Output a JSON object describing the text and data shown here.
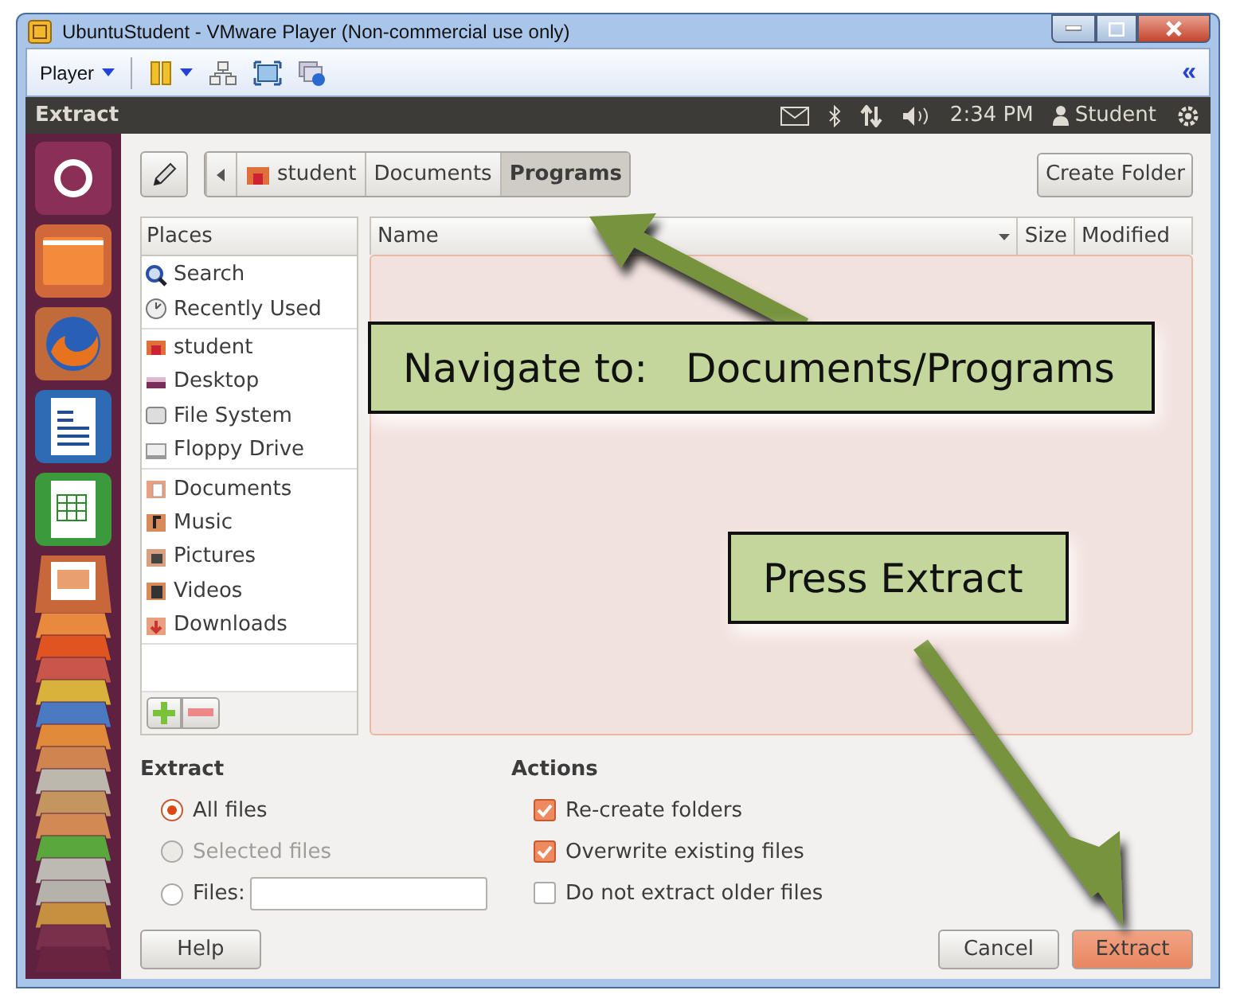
{
  "window": {
    "title": "UbuntuStudent - VMware Player (Non-commercial use only)"
  },
  "toolbar": {
    "player_menu": "Player",
    "collapse": "«"
  },
  "top_panel": {
    "app_title": "Extract",
    "time": "2:34 PM",
    "user": "Student"
  },
  "breadcrumb": [
    {
      "label": "student",
      "selected": false
    },
    {
      "label": "Documents",
      "selected": false
    },
    {
      "label": "Programs",
      "selected": true
    }
  ],
  "create_folder": "Create Folder",
  "places": {
    "header": "Places",
    "groups": [
      [
        {
          "label": "Search"
        },
        {
          "label": "Recently Used"
        }
      ],
      [
        {
          "label": "student"
        },
        {
          "label": "Desktop"
        },
        {
          "label": "File System"
        },
        {
          "label": "Floppy Drive"
        }
      ],
      [
        {
          "label": "Documents"
        },
        {
          "label": "Music"
        },
        {
          "label": "Pictures"
        },
        {
          "label": "Videos"
        },
        {
          "label": "Downloads"
        }
      ]
    ]
  },
  "file_list": {
    "columns": [
      "Name",
      "Size",
      "Modified"
    ]
  },
  "extract": {
    "title": "Extract",
    "options": [
      {
        "kind": "plain",
        "label": "All files",
        "selected": true,
        "disabled": false
      },
      {
        "kind": "plain",
        "label": "Selected files",
        "selected": false,
        "disabled": true
      },
      {
        "kind": "field",
        "label": "Files:",
        "selected": false,
        "disabled": false
      }
    ]
  },
  "actions": {
    "title": "Actions",
    "options": [
      {
        "label": "Re-create folders",
        "checked": true
      },
      {
        "label": "Overwrite existing files",
        "checked": true
      },
      {
        "label": "Do not extract older files",
        "checked": false
      }
    ]
  },
  "buttons": {
    "help": "Help",
    "cancel": "Cancel",
    "extract": "Extract"
  },
  "callouts": [
    {
      "text": "Navigate to:   Documents/Programs"
    },
    {
      "text": "Press Extract"
    }
  ]
}
